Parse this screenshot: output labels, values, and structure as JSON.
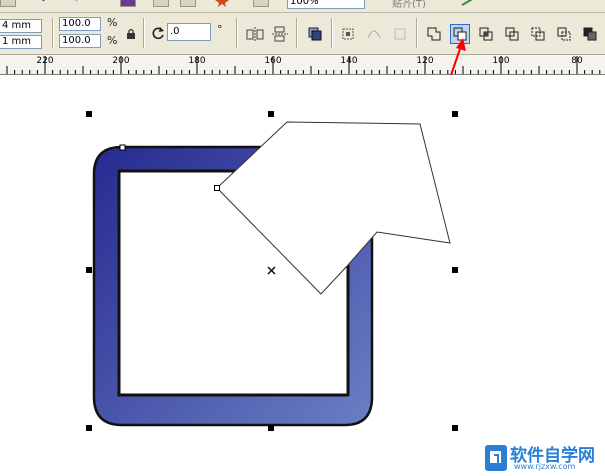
{
  "top_toolbar": {
    "zoom_value": "100%",
    "partial_label": "贴齐(T)"
  },
  "property_bar": {
    "x_value": "4 mm",
    "y_value": "1 mm",
    "scale_x": "100.0",
    "scale_y": "100.0",
    "percent_x": "%",
    "percent_y": "%",
    "rotation": ".0",
    "degree": "°"
  },
  "ruler": {
    "labels": [
      "220",
      "200",
      "180",
      "160",
      "140",
      "120",
      "100",
      "80"
    ]
  },
  "annotation": {
    "arrow_color": "#ff0000"
  },
  "shape": {
    "gradient_start": "#27298f",
    "gradient_end": "#6a7fc4"
  },
  "watermark": {
    "chinese": "软件自学网",
    "url": "www.rjzxw.com",
    "color": "#2a7fd4"
  }
}
